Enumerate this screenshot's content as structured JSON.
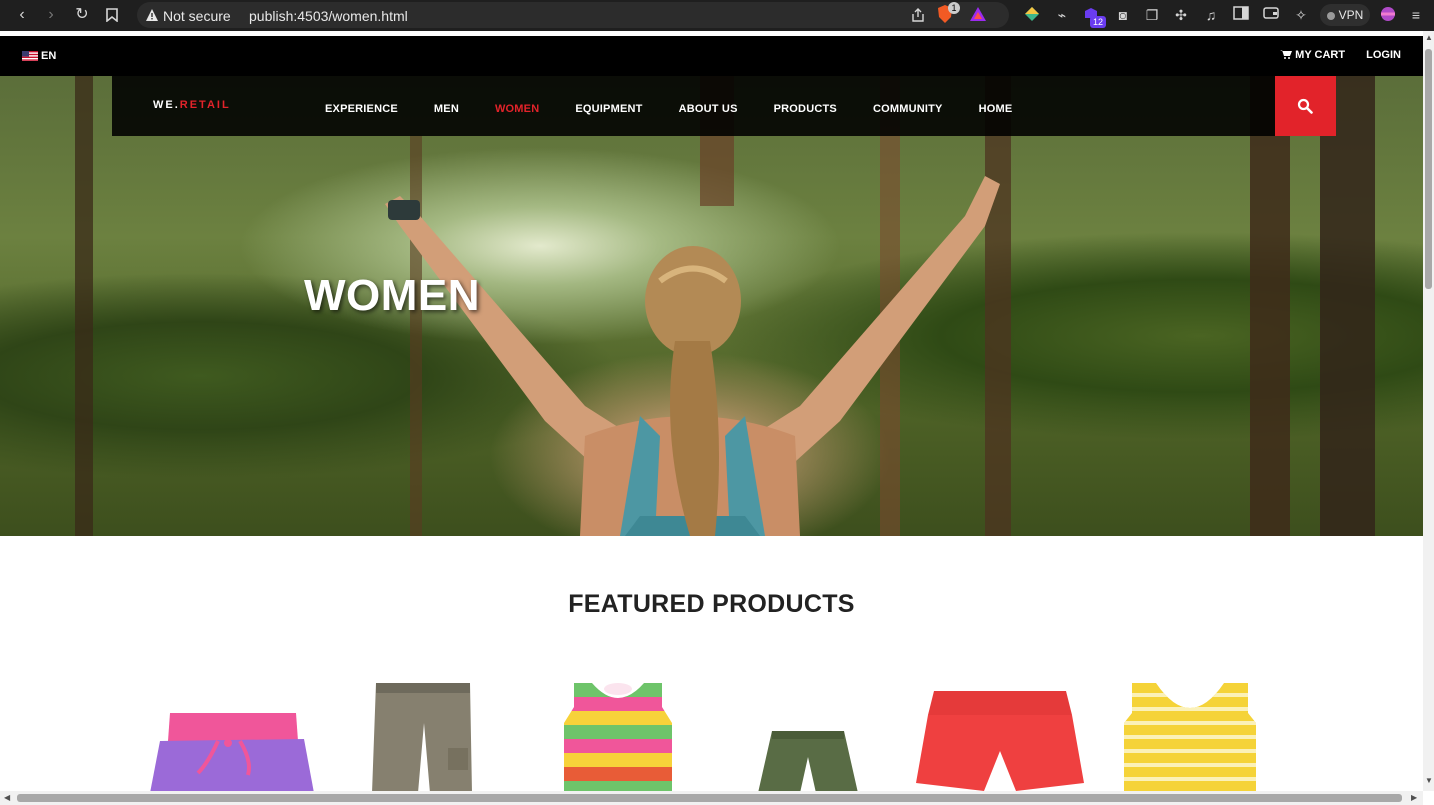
{
  "browser": {
    "security_label": "Not secure",
    "url": "publish:4503/women.html",
    "shields_count": "1",
    "extension_badge": "12",
    "vpn_label": "VPN"
  },
  "topbar": {
    "language": "EN",
    "cart_label": "MY CART",
    "login_label": "LOGIN"
  },
  "brand": {
    "prefix": "WE.",
    "suffix": "RETAIL",
    "accent_color": "#e2232a"
  },
  "nav": {
    "items": [
      {
        "label": "EXPERIENCE"
      },
      {
        "label": "MEN"
      },
      {
        "label": "WOMEN",
        "active": true
      },
      {
        "label": "EQUIPMENT"
      },
      {
        "label": "ABOUT US"
      },
      {
        "label": "PRODUCTS"
      },
      {
        "label": "COMMUNITY"
      },
      {
        "label": "HOME"
      }
    ],
    "search_icon": "search-icon"
  },
  "hero": {
    "title": "WOMEN"
  },
  "featured": {
    "title": "FEATURED PRODUCTS",
    "products": [
      {
        "name": "product-pink-purple-shorts"
      },
      {
        "name": "product-khaki-pants"
      },
      {
        "name": "product-striped-tank-top"
      },
      {
        "name": "product-green-cargo-shorts"
      },
      {
        "name": "product-red-shorts"
      },
      {
        "name": "product-yellow-striped-tank"
      }
    ]
  }
}
